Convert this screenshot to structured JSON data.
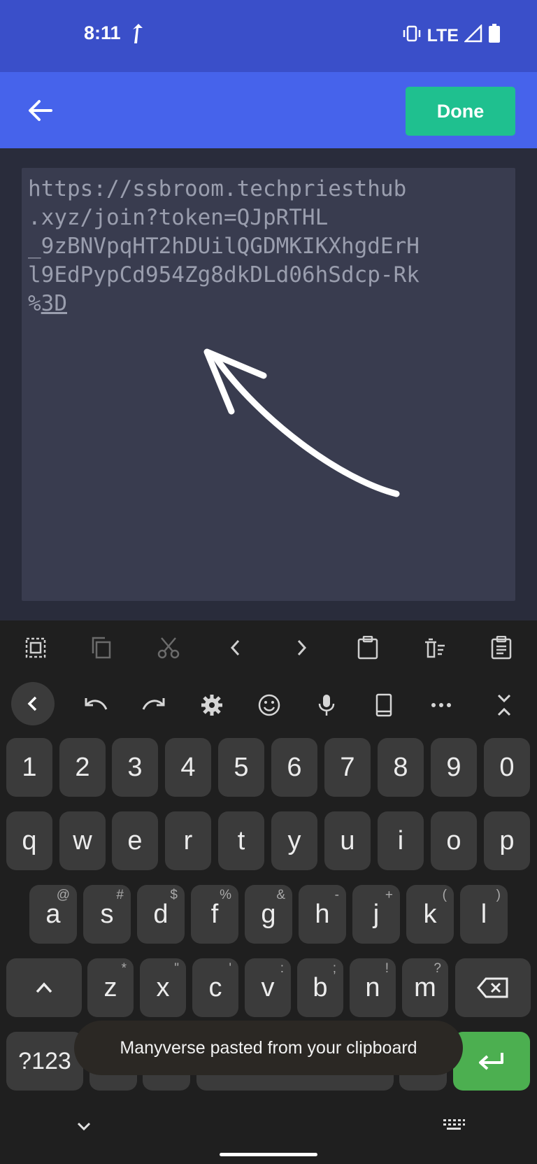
{
  "status_bar": {
    "time": "8:11",
    "network": "LTE"
  },
  "app_bar": {
    "done_label": "Done"
  },
  "editor": {
    "lines": [
      "https://ssbroom.techpriesthub",
      ".xyz/join?token=QJpRTHL",
      "_9zBNVpqHT2hDUilQGDMKIKXhgdErH",
      "l9EdPypCd954Zg8dkDLd06hSdcp-Rk"
    ],
    "last_line_prefix": "%",
    "last_line_underlined": "3D"
  },
  "keyboard": {
    "clipboard_icons": [
      "select-all-icon",
      "copy-icon",
      "cut-icon",
      "chevron-left-icon",
      "chevron-right-icon",
      "paste-icon",
      "clear-icon",
      "clipboard-icon"
    ],
    "toolbar_icons": [
      "collapse-icon",
      "undo-icon",
      "redo-icon",
      "settings-icon",
      "emoji-icon",
      "mic-icon",
      "one-handed-icon",
      "more-icon",
      "close-toolbar-icon"
    ],
    "number_row": [
      "1",
      "2",
      "3",
      "4",
      "5",
      "6",
      "7",
      "8",
      "9",
      "0"
    ],
    "row1": [
      "q",
      "w",
      "e",
      "r",
      "t",
      "y",
      "u",
      "i",
      "o",
      "p"
    ],
    "row2": [
      {
        "key": "a",
        "hint": "@"
      },
      {
        "key": "s",
        "hint": "#"
      },
      {
        "key": "d",
        "hint": "$"
      },
      {
        "key": "f",
        "hint": "%"
      },
      {
        "key": "g",
        "hint": "&"
      },
      {
        "key": "h",
        "hint": "-"
      },
      {
        "key": "j",
        "hint": "+"
      },
      {
        "key": "k",
        "hint": "("
      },
      {
        "key": "l",
        "hint": ")"
      }
    ],
    "row3": [
      {
        "key": "z",
        "hint": "*"
      },
      {
        "key": "x",
        "hint": "\""
      },
      {
        "key": "c",
        "hint": "'"
      },
      {
        "key": "v",
        "hint": ":"
      },
      {
        "key": "b",
        "hint": ";"
      },
      {
        "key": "n",
        "hint": "!"
      },
      {
        "key": "m",
        "hint": "?"
      }
    ],
    "symbols_label": "?123"
  },
  "toast": {
    "message": "Manyverse pasted from your clipboard"
  },
  "colors": {
    "status_bar": "#3a4fc9",
    "app_bar": "#4663eb",
    "done": "#1fc08f",
    "enter_key": "#4caf50"
  }
}
